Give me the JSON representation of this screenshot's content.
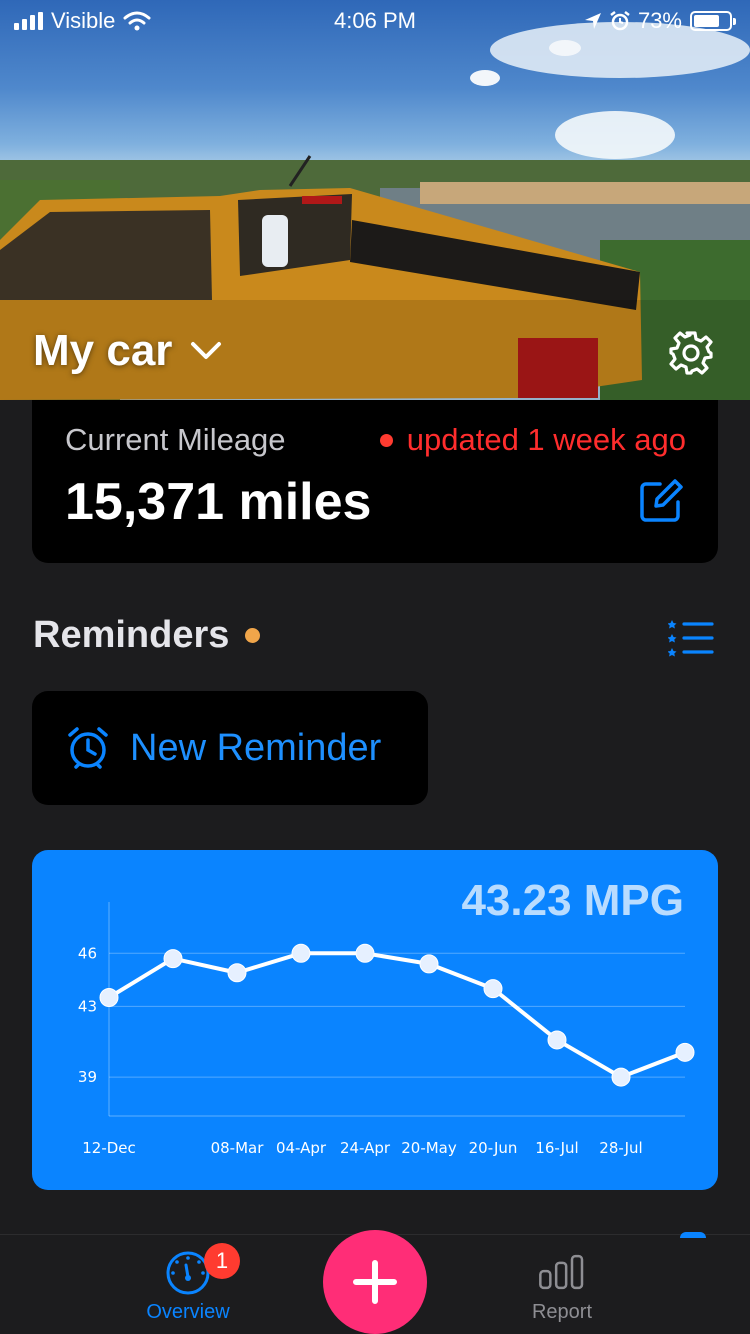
{
  "status_bar": {
    "carrier": "Visible",
    "time": "4:06 PM",
    "battery": "73%",
    "battery_level": 0.73
  },
  "header": {
    "title": "My car"
  },
  "mileage": {
    "label": "Current Mileage",
    "updated": "updated 1 week ago",
    "value": "15,371 miles"
  },
  "reminders": {
    "title": "Reminders",
    "new_label": "New Reminder"
  },
  "mpg": {
    "value": "43.23 MPG"
  },
  "chart_data": {
    "type": "line",
    "x": [
      "12-Dec",
      "",
      "08-Mar",
      "04-Apr",
      "24-Apr",
      "20-May",
      "20-Jun",
      "16-Jul",
      "28-Jul",
      ""
    ],
    "series": [
      {
        "values": [
          43.5,
          45.7,
          44.9,
          46.0,
          46.0,
          45.4,
          44.0,
          41.1,
          39.0,
          40.4
        ]
      }
    ],
    "yticks": [
      39,
      43,
      46
    ],
    "ylim": [
      36.8,
      48.9
    ],
    "grid": true,
    "colors": {
      "line": "#ffffff",
      "background": "#0a84ff"
    }
  },
  "tabbar": {
    "overview": "Overview",
    "overview_badge": "1",
    "report": "Report"
  },
  "colors": {
    "accent": "#0a84ff",
    "alert": "#ff3b30",
    "fab": "#ff2d77",
    "reminder_dot": "#f0a54a"
  }
}
